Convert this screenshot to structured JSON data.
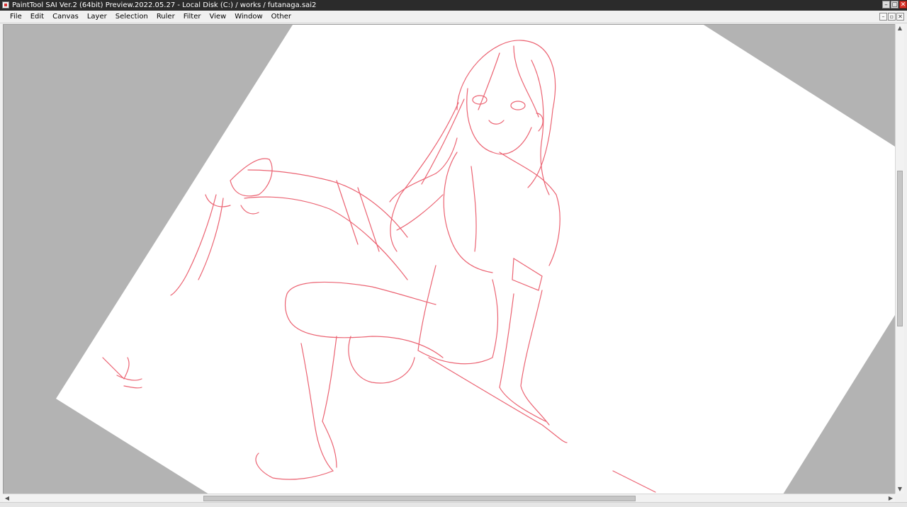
{
  "window": {
    "title": "PaintTool SAI Ver.2 (64bit) Preview.2022.05.27 - Local Disk (C:) / works / futanaga.sai2",
    "controls": {
      "minimize": "–",
      "restore": "▢",
      "close": "✕"
    }
  },
  "menu": {
    "items": [
      "File",
      "Edit",
      "Canvas",
      "Layer",
      "Selection",
      "Ruler",
      "Filter",
      "View",
      "Window",
      "Other"
    ]
  },
  "document_controls": {
    "minimize": "–",
    "restore": "▫",
    "close": "✕"
  },
  "canvas": {
    "background_color": "#b3b3b3",
    "paper_color": "#ffffff",
    "sketch_color": "#e8485a",
    "rotation_deg": -30
  },
  "scrollbars": {
    "vertical_position": 0.52,
    "horizontal_position": 0.47,
    "arrow_up": "▲",
    "arrow_down": "▼",
    "arrow_left": "◀",
    "arrow_right": "▶"
  }
}
